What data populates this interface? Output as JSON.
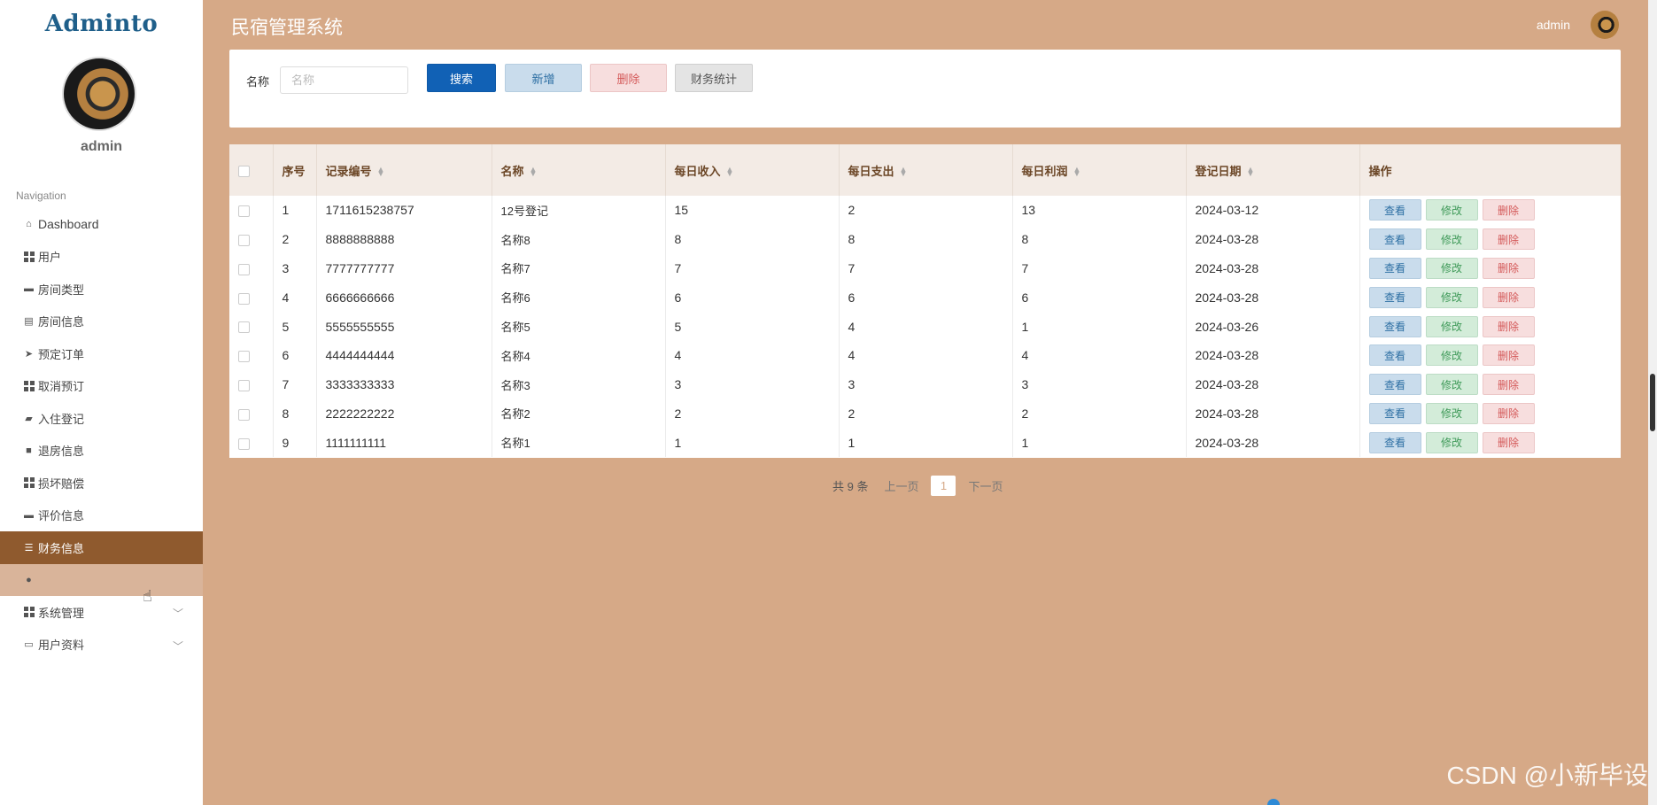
{
  "sidebar": {
    "logo": "Adminto",
    "username": "admin",
    "nav_title": "Navigation",
    "items": [
      {
        "label": "Dashboard",
        "icon": "home-icon"
      },
      {
        "label": "用户",
        "icon": "grid-icon"
      },
      {
        "label": "房间类型",
        "icon": "ticket-icon"
      },
      {
        "label": "房间信息",
        "icon": "database-icon"
      },
      {
        "label": "预定订单",
        "icon": "send-icon"
      },
      {
        "label": "取消预订",
        "icon": "grid-icon"
      },
      {
        "label": "入住登记",
        "icon": "thumbs-up-icon"
      },
      {
        "label": "退房信息",
        "icon": "briefcase-icon"
      },
      {
        "label": "损坏赔偿",
        "icon": "grid-icon"
      },
      {
        "label": "评价信息",
        "icon": "comment-icon"
      },
      {
        "label": "财务信息",
        "icon": "sliders-icon"
      },
      {
        "label": "系统管理",
        "icon": "grid-icon"
      },
      {
        "label": "用户资料",
        "icon": "card-icon"
      }
    ]
  },
  "header": {
    "title": "民宿管理系统",
    "user": "admin"
  },
  "search": {
    "label": "名称",
    "placeholder": "名称",
    "search_btn": "搜索",
    "add_btn": "新增",
    "delete_btn": "删除",
    "finance_btn": "财务统计"
  },
  "table": {
    "headers": [
      "序号",
      "记录编号",
      "名称",
      "每日收入",
      "每日支出",
      "每日利润",
      "登记日期",
      "操作"
    ],
    "rows": [
      [
        "1",
        "1711615238757",
        "12号登记",
        "15",
        "2",
        "13",
        "2024-03-12"
      ],
      [
        "2",
        "8888888888",
        "名称8",
        "8",
        "8",
        "8",
        "2024-03-28"
      ],
      [
        "3",
        "7777777777",
        "名称7",
        "7",
        "7",
        "7",
        "2024-03-28"
      ],
      [
        "4",
        "6666666666",
        "名称6",
        "6",
        "6",
        "6",
        "2024-03-28"
      ],
      [
        "5",
        "5555555555",
        "名称5",
        "5",
        "4",
        "1",
        "2024-03-26"
      ],
      [
        "6",
        "4444444444",
        "名称4",
        "4",
        "4",
        "4",
        "2024-03-28"
      ],
      [
        "7",
        "3333333333",
        "名称3",
        "3",
        "3",
        "3",
        "2024-03-28"
      ],
      [
        "8",
        "2222222222",
        "名称2",
        "2",
        "2",
        "2",
        "2024-03-28"
      ],
      [
        "9",
        "1111111111",
        "名称1",
        "1",
        "1",
        "1",
        "2024-03-28"
      ]
    ],
    "actions": {
      "view": "查看",
      "edit": "修改",
      "delete": "删除"
    }
  },
  "pagination": {
    "total": "共 9 条",
    "prev": "上一页",
    "current": "1",
    "next": "下一页"
  },
  "watermark": "CSDN @小新毕设"
}
